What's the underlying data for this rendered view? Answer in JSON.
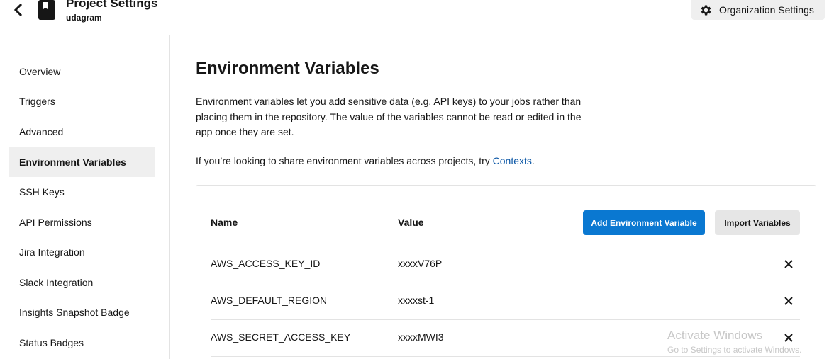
{
  "header": {
    "title": "Project Settings",
    "project_name": "udagram",
    "org_settings_label": "Organization Settings"
  },
  "sidebar": {
    "items": [
      {
        "label": "Overview",
        "active": false
      },
      {
        "label": "Triggers",
        "active": false
      },
      {
        "label": "Advanced",
        "active": false
      },
      {
        "label": "Environment Variables",
        "active": true
      },
      {
        "label": "SSH Keys",
        "active": false
      },
      {
        "label": "API Permissions",
        "active": false
      },
      {
        "label": "Jira Integration",
        "active": false
      },
      {
        "label": "Slack Integration",
        "active": false
      },
      {
        "label": "Insights Snapshot Badge",
        "active": false
      },
      {
        "label": "Status Badges",
        "active": false
      }
    ]
  },
  "main": {
    "title": "Environment Variables",
    "description": "Environment variables let you add sensitive data (e.g. API keys) to your jobs rather than placing them in the repository. The value of the variables cannot be read or edited in the app once they are set.",
    "hint_prefix": "If you’re looking to share environment variables across projects, try ",
    "hint_link": "Contexts",
    "hint_suffix": "."
  },
  "table": {
    "col_name": "Name",
    "col_value": "Value",
    "add_button": "Add Environment Variable",
    "import_button": "Import Variables",
    "rows": [
      {
        "name": "AWS_ACCESS_KEY_ID",
        "value": "xxxxV76P"
      },
      {
        "name": "AWS_DEFAULT_REGION",
        "value": "xxxxst-1"
      },
      {
        "name": "AWS_SECRET_ACCESS_KEY",
        "value": "xxxxMWI3"
      }
    ]
  },
  "watermark": {
    "line1": "Activate Windows",
    "line2": "Go to Settings to activate Windows."
  },
  "colors": {
    "accent": "#0a78d1",
    "link": "#0a56a5",
    "active_bg": "#efefef"
  }
}
